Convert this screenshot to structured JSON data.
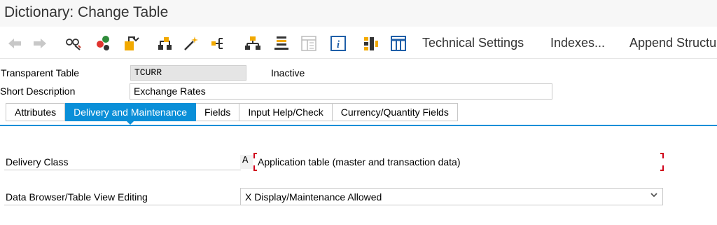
{
  "window": {
    "title": "Dictionary: Change Table"
  },
  "toolbar": {
    "icons": [
      "back-arrow-icon",
      "forward-arrow-icon",
      "display-change-icon",
      "active-inactive-icon",
      "check-object-icon",
      "activate-icon",
      "where-used-icon",
      "object-list-icon",
      "navigation-window-icon",
      "hierarchy-icon",
      "sort-list-icon",
      "documentation-icon",
      "information-icon",
      "contents-icon",
      "table-contents-icon"
    ],
    "technical_settings": "Technical Settings",
    "indexes": "Indexes...",
    "append_structure": "Append Structure"
  },
  "header": {
    "table_type_label": "Transparent Table",
    "table_name": "TCURR",
    "status": "Inactive",
    "short_desc_label": "Short Description",
    "short_desc_value": "Exchange Rates"
  },
  "tabs": [
    {
      "label": "Attributes",
      "active": false
    },
    {
      "label": "Delivery and Maintenance",
      "active": true
    },
    {
      "label": "Fields",
      "active": false
    },
    {
      "label": "Input Help/Check",
      "active": false
    },
    {
      "label": "Currency/Quantity Fields",
      "active": false
    }
  ],
  "delivery": {
    "class_label": "Delivery Class",
    "class_code": "A",
    "class_value": "Application table (master and transaction data)",
    "browser_label": "Data Browser/Table View Editing",
    "browser_value": "X Display/Maintenance Allowed"
  },
  "colors": {
    "accent": "#0a8fd8",
    "error_bracket": "#d0021b"
  }
}
